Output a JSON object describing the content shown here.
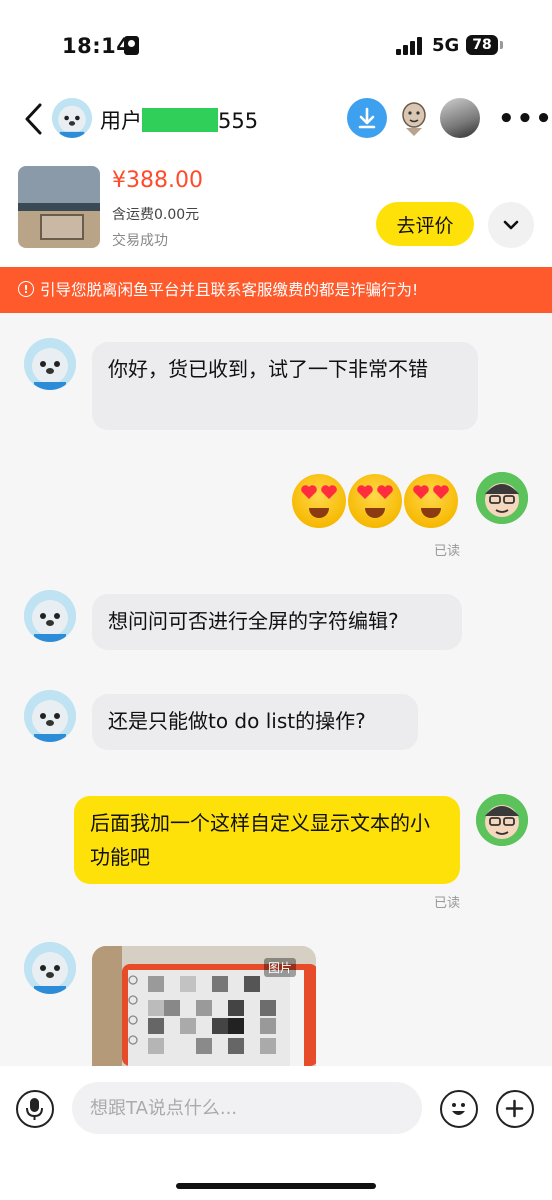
{
  "status_bar": {
    "time": "18:14",
    "network": "5G",
    "battery": "78"
  },
  "header": {
    "username_prefix": "用户",
    "username_suffix": "555",
    "more_label": "•••"
  },
  "product": {
    "price": "¥388.00",
    "shipping": "含运费0.00元",
    "status": "交易成功",
    "review_button": "去评价"
  },
  "warning": {
    "text": "引导您脱离闲鱼平台并且联系客服缴费的都是诈骗行为!"
  },
  "messages": [
    {
      "sender": "other",
      "text": "你好，货已收到，试了一下非常不错"
    },
    {
      "sender": "me",
      "type": "emoji",
      "emoji": [
        "heart-eyes-emoji",
        "heart-eyes-emoji",
        "heart-eyes-emoji"
      ],
      "status": "已读"
    },
    {
      "sender": "other",
      "text": "想问问可否进行全屏的字符编辑?"
    },
    {
      "sender": "other",
      "text": "还是只能做to do list的操作?"
    },
    {
      "sender": "me",
      "text": "后面我加一个这样自定义显示文本的小功能吧",
      "status": "已读"
    },
    {
      "sender": "other",
      "type": "image",
      "tag": "图片"
    }
  ],
  "input_bar": {
    "placeholder": "想跟TA说点什么..."
  },
  "colors": {
    "accent_yellow": "#ffe10a",
    "warning_orange": "#ff5a2c",
    "price_red": "#ff4a2b",
    "download_blue": "#3da1ef"
  }
}
